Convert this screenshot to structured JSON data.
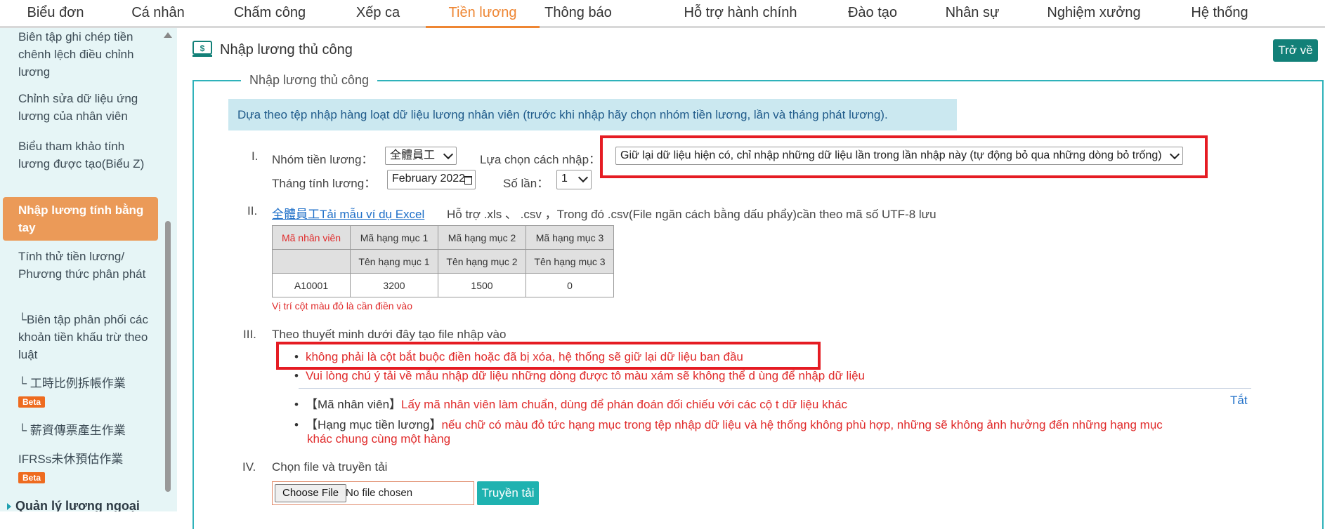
{
  "nav": {
    "items": [
      "Biểu đơn",
      "Cá nhân",
      "Chấm công",
      "Xếp ca",
      "Tiền lương",
      "Thông báo",
      "Hỗ trợ hành chính",
      "Đào tạo",
      "Nhân sự",
      "Nghiệm xưởng",
      "Hệ thống"
    ],
    "active": "Tiền lương"
  },
  "sidebar": {
    "items": [
      "Biên tập ghi chép tiền chênh lệch điều chỉnh lương",
      "Chỉnh sửa dữ liệu ứng lương của nhân viên",
      "Biểu tham khảo tính lương được tạo(Biểu Z)",
      "Nhập lương tính bằng tay",
      "Tính thử tiền lương/ Phương thức phân phát",
      "└Biên tập phân phối các khoản tiền khấu trừ theo luật",
      "└ 工時比例拆帳作業",
      "└ 薪資傳票產生作業",
      "IFRSs未休預估作業",
      "Quản lý lương ngoại"
    ],
    "beta": "Beta"
  },
  "page": {
    "title": "Nhập lương thủ công",
    "back_label": "Trở về",
    "legend": "Nhập lương thủ công",
    "banner": "Dựa theo tệp nhập hàng loạt dữ liệu lương nhân viên (trước khi nhập hãy chọn nhóm tiền lương, lần và tháng phát lương)."
  },
  "step1": {
    "roman": "I.",
    "group_label": "Nhóm tiền lương：",
    "group_value": "全體員工",
    "method_label": "Lựa chọn cách nhập：",
    "method_value": "Giữ lại dữ liệu hiện có, chỉ nhập những dữ liệu lần trong lần nhập này (tự động bỏ qua những dòng bỏ trống)",
    "month_label": "Tháng tính lương：",
    "month_value": "February 2022",
    "times_label": "Số lần：",
    "times_value": "1"
  },
  "step2": {
    "roman": "II.",
    "link": "全體員工Tải mẫu ví dụ Excel",
    "support": "Hỗ trợ .xls 、 .csv ，Trong đó .csv(File ngăn cách bằng dấu phẩy)cần theo mã số UTF-8 lưu",
    "table": {
      "row1": [
        "Mã nhân viên",
        "Mã hạng mục 1",
        "Mã hạng mục 2",
        "Mã hạng mục 3"
      ],
      "row2": [
        "",
        "Tên hạng mục 1",
        "Tên hạng mục 2",
        "Tên hạng mục 3"
      ],
      "row3": [
        "A10001",
        "3200",
        "1500",
        "0"
      ]
    },
    "note": "Vị trí cột màu đỏ là cần điền vào"
  },
  "step3": {
    "roman": "III.",
    "title": "Theo thuyết minh dưới đây tạo file nhập vào",
    "b1": "không phải là cột bắt buộc điền hoặc đã bị xóa, hệ thống sẽ giữ lại dữ liệu ban đầu",
    "b2": "Vui lòng chú ý tải về mẫu nhập dữ liệu những dòng được tô màu xám sẽ không thể d ùng để nhập dữ liệu",
    "b3_prefix": "【Mã nhân viên】",
    "b3_text": "Lấy mã nhân viên làm chuẩn, dùng để phán đoán đối chiếu với các cộ t dữ liệu khác",
    "b4_prefix": "【Hạng mục tiền lương】",
    "b4_text_line1": "nếu chữ có màu đỏ tức hạng mục trong tệp nhập dữ liệu và hệ thống không phù hợp, những sẽ không ảnh hưởng đến những hạng mục",
    "b4_text_line2": "khác chung cùng một hàng",
    "collapse": "Tắt"
  },
  "step4": {
    "roman": "IV.",
    "title": "Chọn file và truyền tải",
    "choose_label": "Choose File",
    "no_file": "No file chosen",
    "upload_label": "Truyền tải"
  },
  "colors": {
    "accent": "#ee8633",
    "teal": "#128078",
    "panel_border": "#2fb2ba",
    "highlight": "#e51c23"
  }
}
